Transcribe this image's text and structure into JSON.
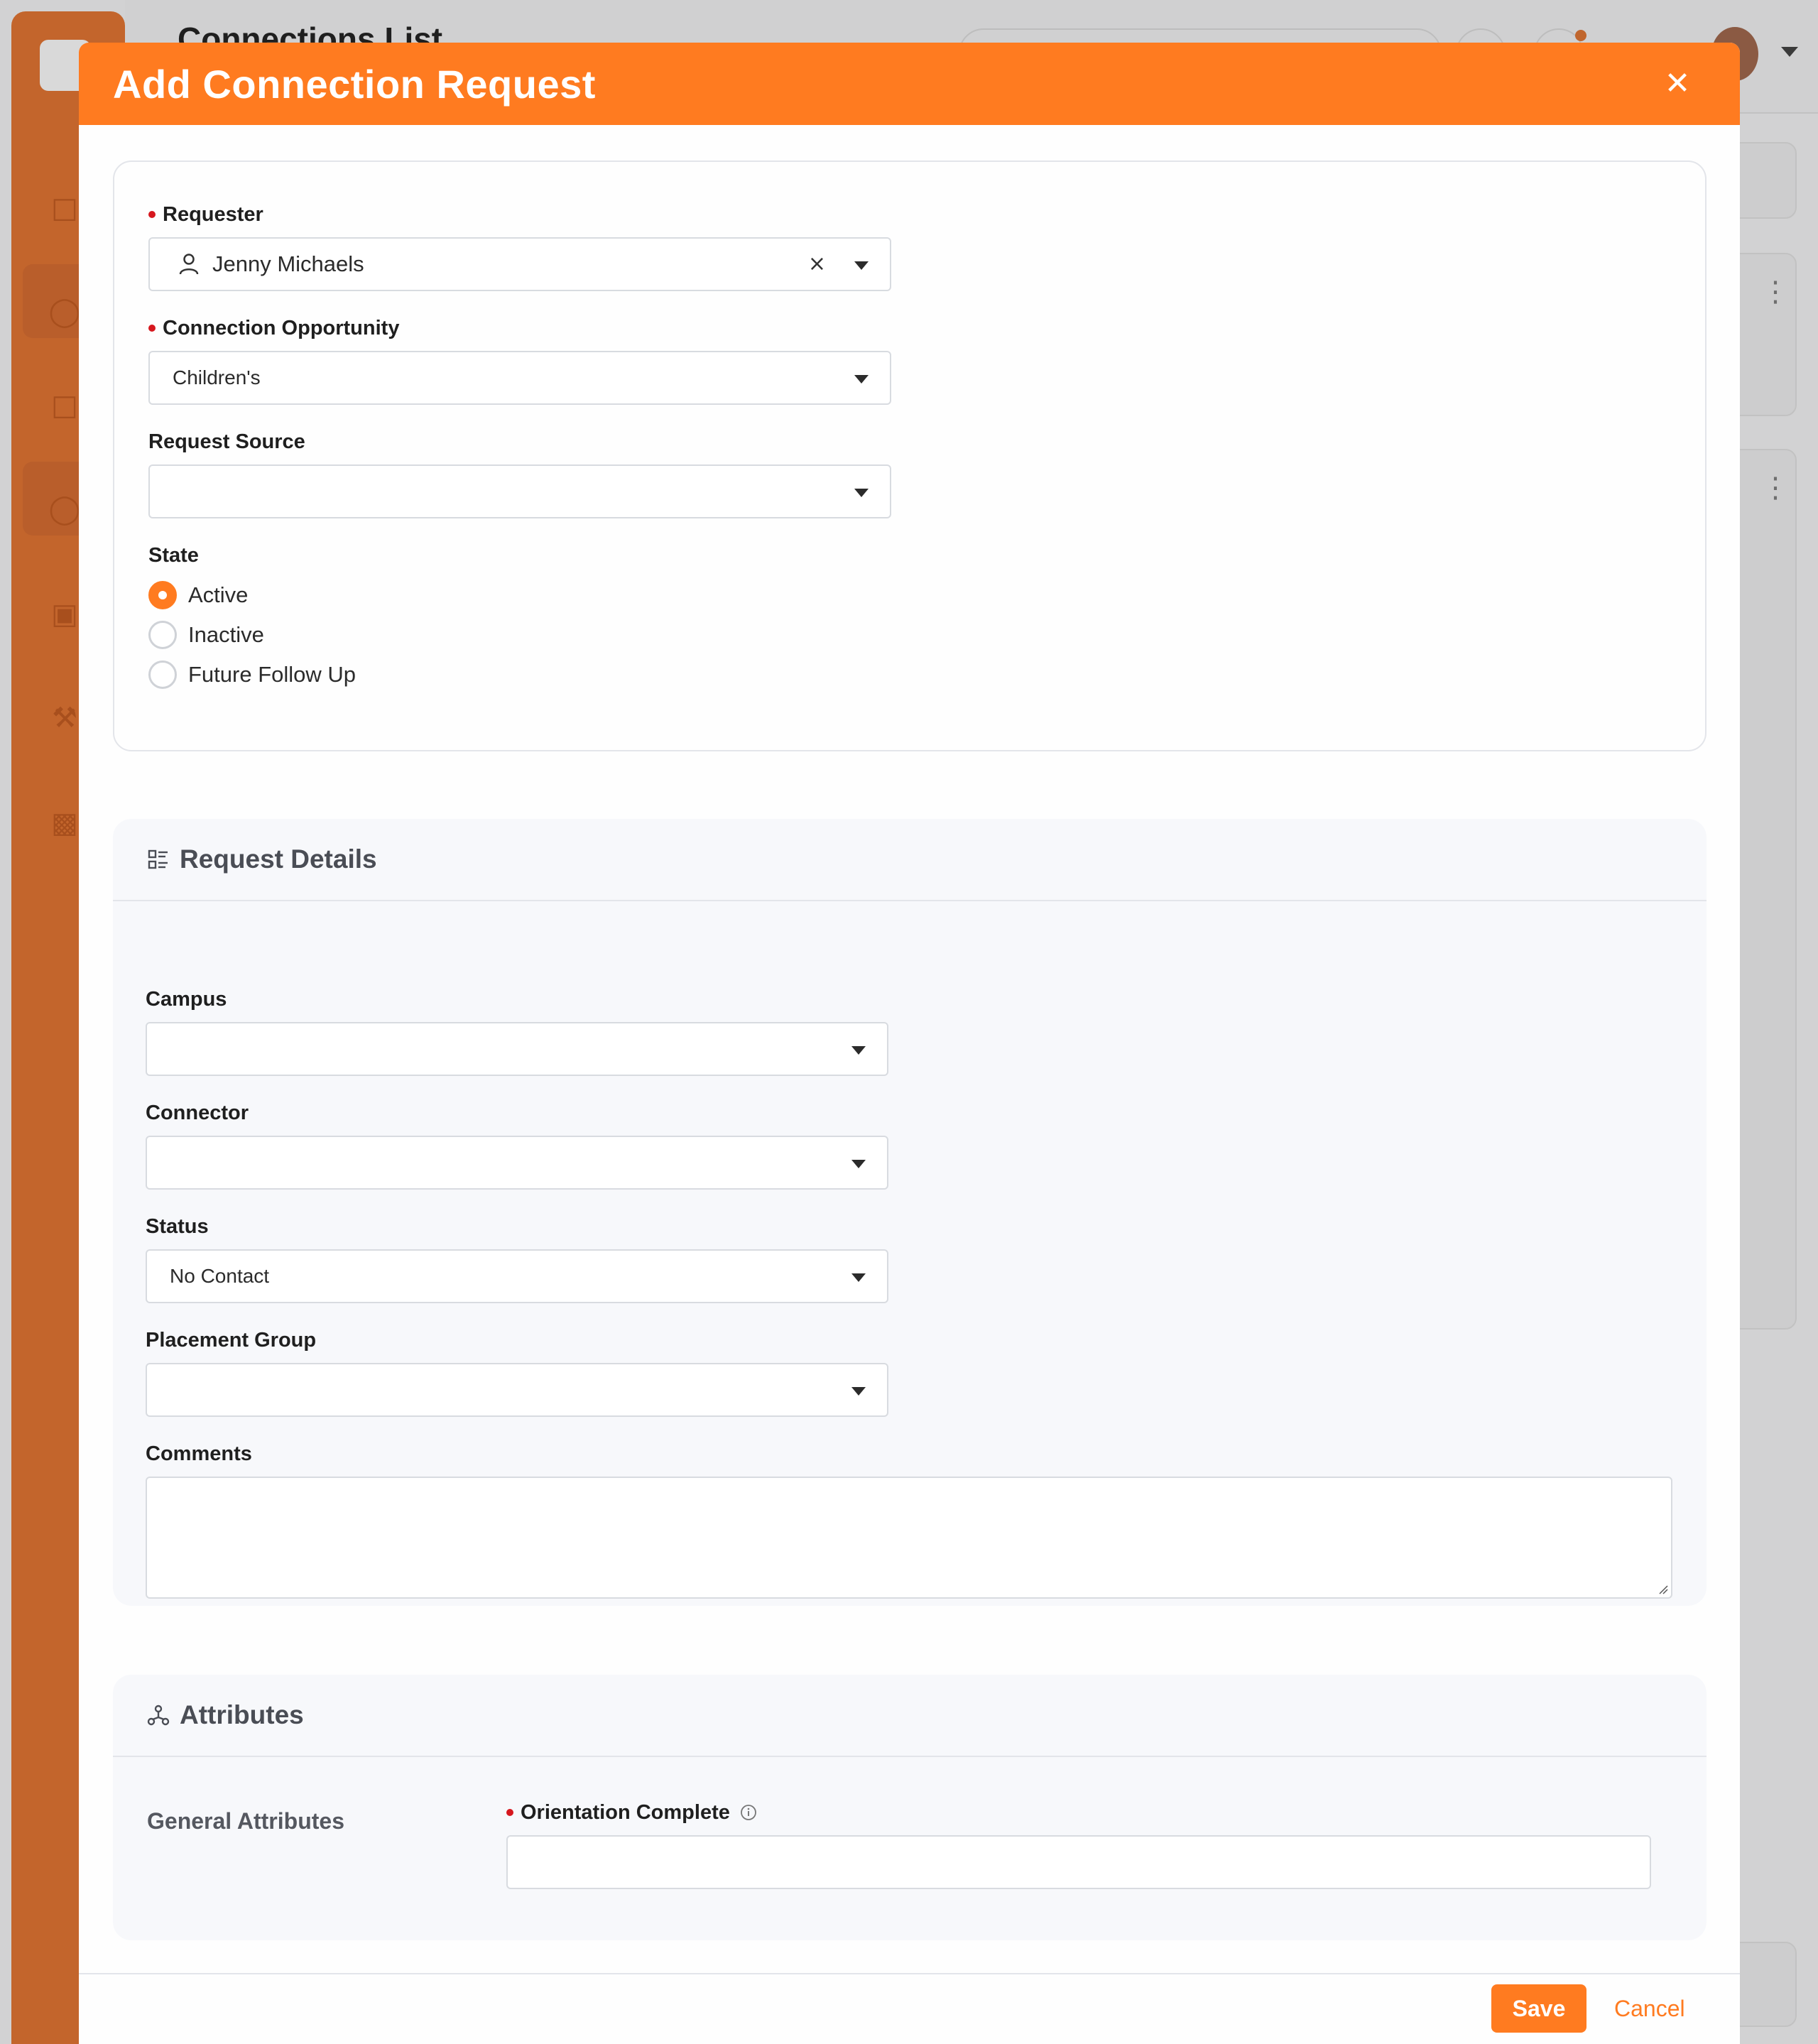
{
  "background": {
    "page_title": "Connections List"
  },
  "modal": {
    "title": "Add Connection Request",
    "close_icon": "close-icon"
  },
  "form": {
    "requester": {
      "label": "Requester",
      "value": "Jenny Michaels",
      "required": true
    },
    "connection_opportunity": {
      "label": "Connection Opportunity",
      "value": "Children's",
      "required": true
    },
    "request_source": {
      "label": "Request Source",
      "value": ""
    },
    "state": {
      "label": "State",
      "options": [
        "Active",
        "Inactive",
        "Future Follow Up"
      ],
      "selected": "Active"
    }
  },
  "request_details": {
    "title": "Request Details",
    "campus": {
      "label": "Campus",
      "value": ""
    },
    "connector": {
      "label": "Connector",
      "value": ""
    },
    "status": {
      "label": "Status",
      "value": "No Contact"
    },
    "placement_group": {
      "label": "Placement Group",
      "value": ""
    },
    "comments": {
      "label": "Comments",
      "value": ""
    }
  },
  "attributes": {
    "title": "Attributes",
    "group_label": "General Attributes",
    "orientation_complete": {
      "label": "Orientation Complete",
      "value": "",
      "required": true
    }
  },
  "footer": {
    "save_label": "Save",
    "cancel_label": "Cancel"
  },
  "colors": {
    "accent": "#ff7b20",
    "required": "#d6171e",
    "sidebar": "#c3652c"
  }
}
